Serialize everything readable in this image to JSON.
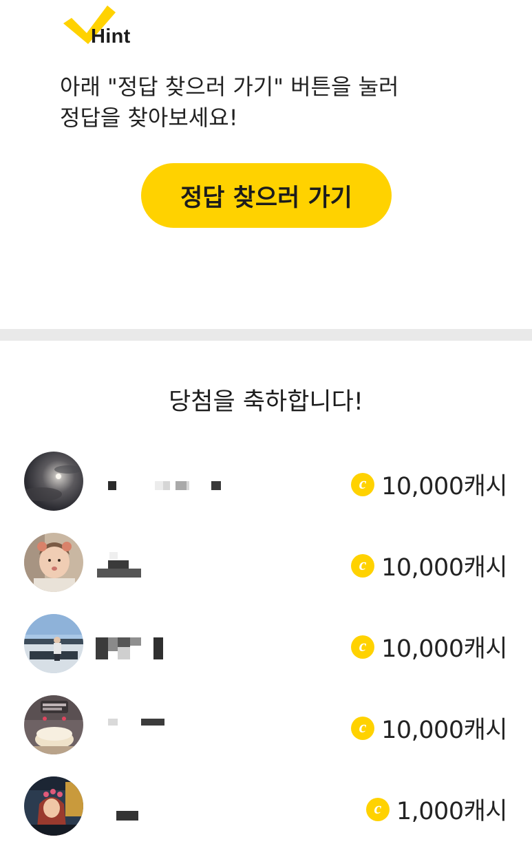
{
  "hint": {
    "label": "Hint",
    "message_line1": "아래 \"정답 찾으러 가기\" 버튼을 눌러",
    "message_line2": "정답을 찾아보세요!",
    "button_label": "정답 찾으러 가기"
  },
  "winners": {
    "title": "당첨을 축하합니다!",
    "items": [
      {
        "avatar": "moon-night-sky-photo",
        "reward": "10,000캐시"
      },
      {
        "avatar": "child-portrait-photo",
        "reward": "10,000캐시"
      },
      {
        "avatar": "person-outdoor-lake-photo",
        "reward": "10,000캐시"
      },
      {
        "avatar": "birthday-cake-photo",
        "reward": "10,000캐시"
      },
      {
        "avatar": "illustrated-character-photo",
        "reward": "1,000캐시"
      }
    ]
  },
  "icons": {
    "hint": "checkmark-icon",
    "coin": "cash-coin-icon"
  },
  "colors": {
    "accent": "#ffd200",
    "divider": "#e9e9e9",
    "text": "#1c1c1c"
  }
}
